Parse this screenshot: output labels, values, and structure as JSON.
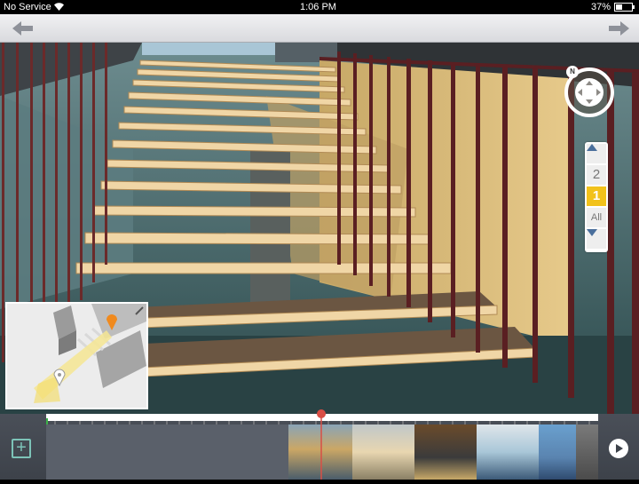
{
  "status_bar": {
    "carrier": "No Service",
    "time": "1:06 PM",
    "battery": "37%",
    "wifi_icon": "wifi-icon",
    "battery_icon": "battery-icon"
  },
  "nav": {
    "back_icon": "arrow-left-icon",
    "forward_icon": "arrow-right-icon"
  },
  "compass": {
    "north_label": "N"
  },
  "floor_selector": {
    "up_icon": "chevron-up-icon",
    "floors": [
      "2",
      "1",
      "All"
    ],
    "selected": "1",
    "down_icon": "chevron-down-icon"
  },
  "timeline": {
    "add_icon": "plus-icon",
    "play_icon": "play-icon",
    "playhead_position": 0.5,
    "thumbnail_count": 6
  },
  "colors": {
    "selected_floor": "#f2c21b",
    "add_button": "#7dc3b8",
    "map_marker": "#f08a1e",
    "playhead": "#d94e45"
  }
}
